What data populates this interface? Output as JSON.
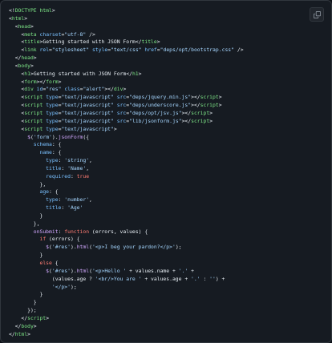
{
  "toolbar": {
    "copy_icon": "copy-icon"
  },
  "code": {
    "language": "html",
    "lines": [
      [
        [
          "punct",
          "<!"
        ],
        [
          "tag",
          "DOCTYPE html"
        ],
        [
          "punct",
          ">"
        ]
      ],
      [
        [
          "punct",
          "<"
        ],
        [
          "tag",
          "html"
        ],
        [
          "punct",
          ">"
        ]
      ],
      [
        [
          "plain",
          "  "
        ],
        [
          "punct",
          "<"
        ],
        [
          "tag",
          "head"
        ],
        [
          "punct",
          ">"
        ]
      ],
      [
        [
          "plain",
          "    "
        ],
        [
          "punct",
          "<"
        ],
        [
          "tag",
          "meta"
        ],
        [
          "plain",
          " "
        ],
        [
          "attr",
          "charset"
        ],
        [
          "punct",
          "="
        ],
        [
          "str",
          "\"utf-8\""
        ],
        [
          "plain",
          " "
        ],
        [
          "punct",
          "/>"
        ]
      ],
      [
        [
          "plain",
          "    "
        ],
        [
          "punct",
          "<"
        ],
        [
          "tag",
          "title"
        ],
        [
          "punct",
          ">"
        ],
        [
          "plain",
          "Getting started with JSON Form"
        ],
        [
          "punct",
          "</"
        ],
        [
          "tag",
          "title"
        ],
        [
          "punct",
          ">"
        ]
      ],
      [
        [
          "plain",
          "    "
        ],
        [
          "punct",
          "<"
        ],
        [
          "tag",
          "link"
        ],
        [
          "plain",
          " "
        ],
        [
          "attr",
          "rel"
        ],
        [
          "punct",
          "="
        ],
        [
          "str",
          "\"stylesheet\""
        ],
        [
          "plain",
          " "
        ],
        [
          "attr",
          "style"
        ],
        [
          "punct",
          "="
        ],
        [
          "str",
          "\"text/css\""
        ],
        [
          "plain",
          " "
        ],
        [
          "attr",
          "href"
        ],
        [
          "punct",
          "="
        ],
        [
          "str",
          "\"deps/opt/bootstrap.css\""
        ],
        [
          "plain",
          " "
        ],
        [
          "punct",
          "/>"
        ]
      ],
      [
        [
          "plain",
          "  "
        ],
        [
          "punct",
          "</"
        ],
        [
          "tag",
          "head"
        ],
        [
          "punct",
          ">"
        ]
      ],
      [
        [
          "plain",
          "  "
        ],
        [
          "punct",
          "<"
        ],
        [
          "tag",
          "body"
        ],
        [
          "punct",
          ">"
        ]
      ],
      [
        [
          "plain",
          "    "
        ],
        [
          "punct",
          "<"
        ],
        [
          "tag",
          "h1"
        ],
        [
          "punct",
          ">"
        ],
        [
          "plain",
          "Getting started with JSON Form"
        ],
        [
          "punct",
          "</"
        ],
        [
          "tag",
          "h1"
        ],
        [
          "punct",
          ">"
        ]
      ],
      [
        [
          "plain",
          "    "
        ],
        [
          "punct",
          "<"
        ],
        [
          "tag",
          "form"
        ],
        [
          "punct",
          "></"
        ],
        [
          "tag",
          "form"
        ],
        [
          "punct",
          ">"
        ]
      ],
      [
        [
          "plain",
          "    "
        ],
        [
          "punct",
          "<"
        ],
        [
          "tag",
          "div"
        ],
        [
          "plain",
          " "
        ],
        [
          "attr",
          "id"
        ],
        [
          "punct",
          "="
        ],
        [
          "str",
          "\"res\""
        ],
        [
          "plain",
          " "
        ],
        [
          "attr",
          "class"
        ],
        [
          "punct",
          "="
        ],
        [
          "str",
          "\"alert\""
        ],
        [
          "punct",
          "></"
        ],
        [
          "tag",
          "div"
        ],
        [
          "punct",
          ">"
        ]
      ],
      [
        [
          "plain",
          "    "
        ],
        [
          "punct",
          "<"
        ],
        [
          "tag",
          "script"
        ],
        [
          "plain",
          " "
        ],
        [
          "attr",
          "type"
        ],
        [
          "punct",
          "="
        ],
        [
          "str",
          "\"text/javascript\""
        ],
        [
          "plain",
          " "
        ],
        [
          "attr",
          "src"
        ],
        [
          "punct",
          "="
        ],
        [
          "str",
          "\"deps/jquery.min.js\""
        ],
        [
          "punct",
          "></"
        ],
        [
          "tag",
          "script"
        ],
        [
          "punct",
          ">"
        ]
      ],
      [
        [
          "plain",
          "    "
        ],
        [
          "punct",
          "<"
        ],
        [
          "tag",
          "script"
        ],
        [
          "plain",
          " "
        ],
        [
          "attr",
          "type"
        ],
        [
          "punct",
          "="
        ],
        [
          "str",
          "\"text/javascript\""
        ],
        [
          "plain",
          " "
        ],
        [
          "attr",
          "src"
        ],
        [
          "punct",
          "="
        ],
        [
          "str",
          "\"deps/underscore.js\""
        ],
        [
          "punct",
          "></"
        ],
        [
          "tag",
          "script"
        ],
        [
          "punct",
          ">"
        ]
      ],
      [
        [
          "plain",
          "    "
        ],
        [
          "punct",
          "<"
        ],
        [
          "tag",
          "script"
        ],
        [
          "plain",
          " "
        ],
        [
          "attr",
          "type"
        ],
        [
          "punct",
          "="
        ],
        [
          "str",
          "\"text/javascript\""
        ],
        [
          "plain",
          " "
        ],
        [
          "attr",
          "src"
        ],
        [
          "punct",
          "="
        ],
        [
          "str",
          "\"deps/opt/jsv.js\""
        ],
        [
          "punct",
          "></"
        ],
        [
          "tag",
          "script"
        ],
        [
          "punct",
          ">"
        ]
      ],
      [
        [
          "plain",
          "    "
        ],
        [
          "punct",
          "<"
        ],
        [
          "tag",
          "script"
        ],
        [
          "plain",
          " "
        ],
        [
          "attr",
          "type"
        ],
        [
          "punct",
          "="
        ],
        [
          "str",
          "\"text/javascript\""
        ],
        [
          "plain",
          " "
        ],
        [
          "attr",
          "src"
        ],
        [
          "punct",
          "="
        ],
        [
          "str",
          "\"lib/jsonform.js\""
        ],
        [
          "punct",
          "></"
        ],
        [
          "tag",
          "script"
        ],
        [
          "punct",
          ">"
        ]
      ],
      [
        [
          "plain",
          "    "
        ],
        [
          "punct",
          "<"
        ],
        [
          "tag",
          "script"
        ],
        [
          "plain",
          " "
        ],
        [
          "attr",
          "type"
        ],
        [
          "punct",
          "="
        ],
        [
          "str",
          "\"text/javascript\""
        ],
        [
          "punct",
          ">"
        ]
      ],
      [
        [
          "plain",
          "      "
        ],
        [
          "fn",
          "$"
        ],
        [
          "punct",
          "("
        ],
        [
          "str",
          "'form'"
        ],
        [
          "punct",
          ")."
        ],
        [
          "fn",
          "jsonForm"
        ],
        [
          "punct",
          "({"
        ]
      ],
      [
        [
          "plain",
          "        "
        ],
        [
          "prop",
          "schema"
        ],
        [
          "punct",
          ": {"
        ]
      ],
      [
        [
          "plain",
          "          "
        ],
        [
          "prop",
          "name"
        ],
        [
          "punct",
          ": {"
        ]
      ],
      [
        [
          "plain",
          "            "
        ],
        [
          "prop",
          "type"
        ],
        [
          "punct",
          ": "
        ],
        [
          "str",
          "'string'"
        ],
        [
          "punct",
          ","
        ]
      ],
      [
        [
          "plain",
          "            "
        ],
        [
          "prop",
          "title"
        ],
        [
          "punct",
          ": "
        ],
        [
          "str",
          "'Name'"
        ],
        [
          "punct",
          ","
        ]
      ],
      [
        [
          "plain",
          "            "
        ],
        [
          "prop",
          "required"
        ],
        [
          "punct",
          ": "
        ],
        [
          "kw",
          "true"
        ]
      ],
      [
        [
          "plain",
          "          "
        ],
        [
          "punct",
          "},"
        ]
      ],
      [
        [
          "plain",
          "          "
        ],
        [
          "prop",
          "age"
        ],
        [
          "punct",
          ": {"
        ]
      ],
      [
        [
          "plain",
          "            "
        ],
        [
          "prop",
          "type"
        ],
        [
          "punct",
          ": "
        ],
        [
          "str",
          "'number'"
        ],
        [
          "punct",
          ","
        ]
      ],
      [
        [
          "plain",
          "            "
        ],
        [
          "prop",
          "title"
        ],
        [
          "punct",
          ": "
        ],
        [
          "str",
          "'Age'"
        ]
      ],
      [
        [
          "plain",
          "          "
        ],
        [
          "punct",
          "}"
        ]
      ],
      [
        [
          "plain",
          "        "
        ],
        [
          "punct",
          "},"
        ]
      ],
      [
        [
          "plain",
          "        "
        ],
        [
          "fn",
          "onSubmit"
        ],
        [
          "punct",
          ": "
        ],
        [
          "kw",
          "function"
        ],
        [
          "plain",
          " "
        ],
        [
          "punct",
          "("
        ],
        [
          "plain",
          "errors, values"
        ],
        [
          "punct",
          ") {"
        ]
      ],
      [
        [
          "plain",
          "          "
        ],
        [
          "kw",
          "if"
        ],
        [
          "plain",
          " "
        ],
        [
          "punct",
          "("
        ],
        [
          "plain",
          "errors"
        ],
        [
          "punct",
          ") {"
        ]
      ],
      [
        [
          "plain",
          "            "
        ],
        [
          "fn",
          "$"
        ],
        [
          "punct",
          "("
        ],
        [
          "str",
          "'#res'"
        ],
        [
          "punct",
          ")."
        ],
        [
          "fn",
          "html"
        ],
        [
          "punct",
          "("
        ],
        [
          "str",
          "'<p>I beg your pardon?</p>'"
        ],
        [
          "punct",
          ");"
        ]
      ],
      [
        [
          "plain",
          "          "
        ],
        [
          "punct",
          "}"
        ]
      ],
      [
        [
          "plain",
          "          "
        ],
        [
          "kw",
          "else"
        ],
        [
          "plain",
          " "
        ],
        [
          "punct",
          "{"
        ]
      ],
      [
        [
          "plain",
          "            "
        ],
        [
          "fn",
          "$"
        ],
        [
          "punct",
          "("
        ],
        [
          "str",
          "'#res'"
        ],
        [
          "punct",
          ")."
        ],
        [
          "fn",
          "html"
        ],
        [
          "punct",
          "("
        ],
        [
          "str",
          "'<p>Hello '"
        ],
        [
          "plain",
          " + values.name + "
        ],
        [
          "str",
          "'.'"
        ],
        [
          "plain",
          " +"
        ]
      ],
      [
        [
          "plain",
          "              "
        ],
        [
          "punct",
          "("
        ],
        [
          "plain",
          "values.age ? "
        ],
        [
          "str",
          "'<br/>You are '"
        ],
        [
          "plain",
          " + values.age + "
        ],
        [
          "str",
          "'.'"
        ],
        [
          "plain",
          " : "
        ],
        [
          "str",
          "''"
        ],
        [
          "punct",
          ")"
        ],
        [
          "plain",
          " +"
        ]
      ],
      [
        [
          "plain",
          "              "
        ],
        [
          "str",
          "'</p>'"
        ],
        [
          "punct",
          ");"
        ]
      ],
      [
        [
          "plain",
          "          "
        ],
        [
          "punct",
          "}"
        ]
      ],
      [
        [
          "plain",
          "        "
        ],
        [
          "punct",
          "}"
        ]
      ],
      [
        [
          "plain",
          "      "
        ],
        [
          "punct",
          "});"
        ]
      ],
      [
        [
          "plain",
          "    "
        ],
        [
          "punct",
          "</"
        ],
        [
          "tag",
          "script"
        ],
        [
          "punct",
          ">"
        ]
      ],
      [
        [
          "plain",
          "  "
        ],
        [
          "punct",
          "</"
        ],
        [
          "tag",
          "body"
        ],
        [
          "punct",
          ">"
        ]
      ],
      [
        [
          "punct",
          "</"
        ],
        [
          "tag",
          "html"
        ],
        [
          "punct",
          ">"
        ]
      ]
    ]
  }
}
